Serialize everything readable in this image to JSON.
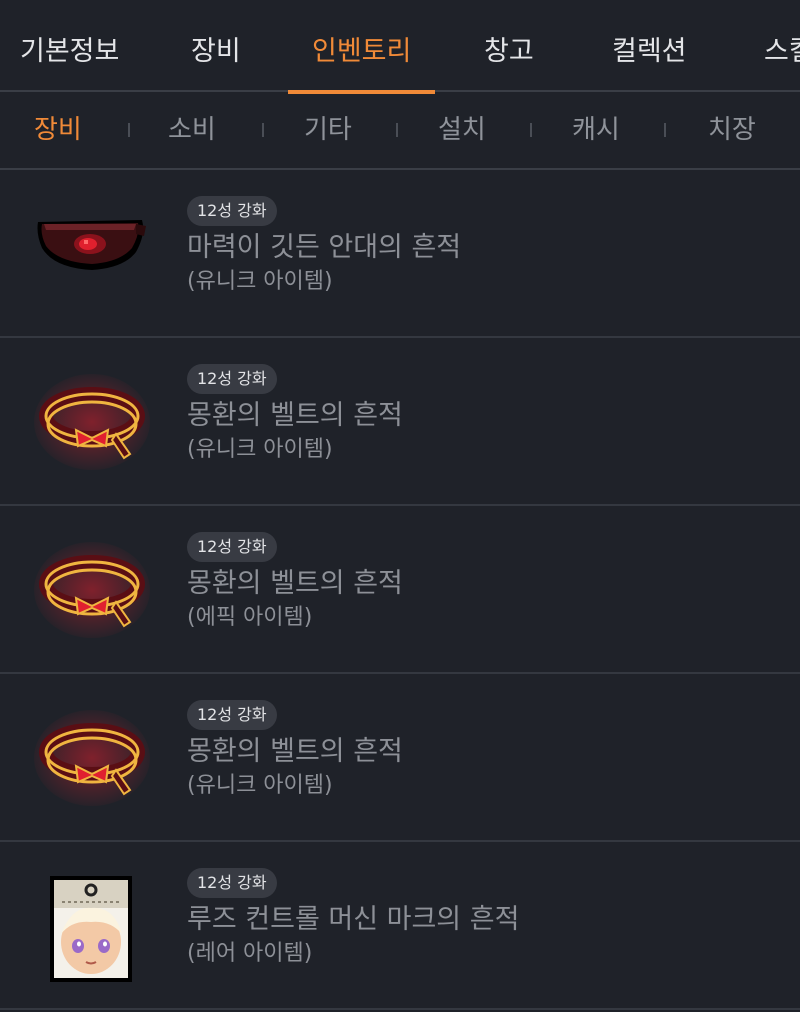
{
  "main_tabs": [
    {
      "label": "기본정보",
      "active": false
    },
    {
      "label": "장비",
      "active": false
    },
    {
      "label": "인벤토리",
      "active": true
    },
    {
      "label": "창고",
      "active": false
    },
    {
      "label": "컬렉션",
      "active": false
    },
    {
      "label": "스킬",
      "active": false
    }
  ],
  "sub_tabs": [
    {
      "label": "장비",
      "active": true
    },
    {
      "label": "소비",
      "active": false
    },
    {
      "label": "기타",
      "active": false
    },
    {
      "label": "설치",
      "active": false
    },
    {
      "label": "캐시",
      "active": false
    },
    {
      "label": "치장",
      "active": false
    }
  ],
  "items": [
    {
      "badge": "12성 강화",
      "name": "마력이 깃든 안대의 흔적",
      "grade": "(유니크 아이템)",
      "icon": "eyepatch-icon"
    },
    {
      "badge": "12성 강화",
      "name": "몽환의 벨트의 흔적",
      "grade": "(유니크 아이템)",
      "icon": "belt-icon"
    },
    {
      "badge": "12성 강화",
      "name": "몽환의 벨트의 흔적",
      "grade": "(에픽 아이템)",
      "icon": "belt-icon"
    },
    {
      "badge": "12성 강화",
      "name": "몽환의 벨트의 흔적",
      "grade": "(유니크 아이템)",
      "icon": "belt-icon"
    },
    {
      "badge": "12성 강화",
      "name": "루즈 컨트롤 머신 마크의 흔적",
      "grade": "(레어 아이템)",
      "icon": "machine-mark-icon"
    }
  ],
  "colors": {
    "background": "#1f2229",
    "accent": "#f08a38",
    "divider": "#3a3e46",
    "muted_text": "#8d9097",
    "badge_bg": "#383b43"
  }
}
